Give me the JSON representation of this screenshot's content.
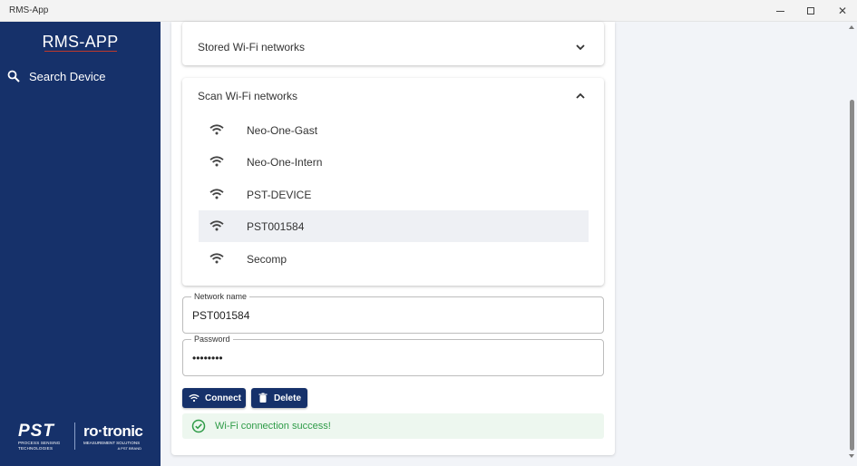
{
  "window": {
    "title": "RMS-App",
    "minimize_icon": "minimize-icon",
    "maximize_icon": "maximize-icon",
    "close_icon": "close-icon",
    "close_symbol": "✕"
  },
  "sidebar": {
    "brand": "RMS-APP",
    "nav": [
      {
        "label": "Search Device",
        "icon": "search-icon"
      }
    ],
    "logos": {
      "pst": {
        "name": "PST",
        "tagline1": "PROCESS SENSING",
        "tagline2": "TECHNOLOGIES"
      },
      "rotronic": {
        "name": "ro·tronic",
        "tagline1": "MEASUREMENT SOLUTIONS",
        "tagline2": "A PST BRAND"
      }
    }
  },
  "stored_panel": {
    "title": "Stored Wi-Fi networks",
    "state": "collapsed"
  },
  "scan_panel": {
    "title": "Scan Wi-Fi networks",
    "state": "expanded",
    "networks": [
      {
        "name": "Neo-One-Gast",
        "selected": false
      },
      {
        "name": "Neo-One-Intern",
        "selected": false
      },
      {
        "name": "PST-DEVICE",
        "selected": false
      },
      {
        "name": "PST001584",
        "selected": true
      },
      {
        "name": "Secomp",
        "selected": false
      }
    ]
  },
  "form": {
    "network_name": {
      "label": "Network name",
      "value": "PST001584"
    },
    "password": {
      "label": "Password",
      "value": "••••••••"
    }
  },
  "buttons": {
    "connect": {
      "label": "Connect",
      "icon": "wifi-icon"
    },
    "delete": {
      "label": "Delete",
      "icon": "trash-icon"
    }
  },
  "status": {
    "message": "Wi-Fi connection success!",
    "icon": "check-circle-icon",
    "color": "#2e9b47"
  },
  "colors": {
    "sidebar": "#16316a",
    "accent": "#16316a",
    "brand_underline": "#c0392b",
    "selected_row": "#eef0f4"
  }
}
